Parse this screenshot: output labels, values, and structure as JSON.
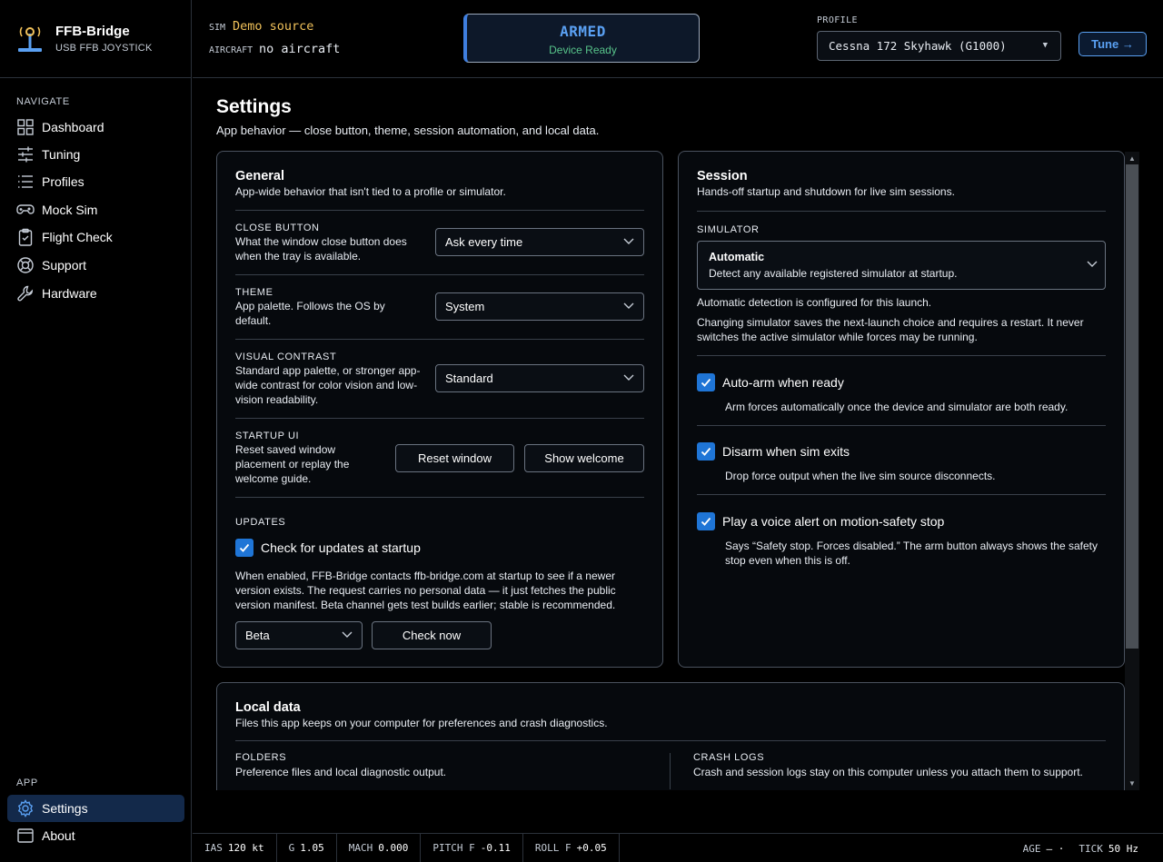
{
  "brand": {
    "title": "FFB-Bridge",
    "subtitle": "USB FFB JOYSTICK"
  },
  "nav": {
    "heading": "NAVIGATE",
    "items": [
      {
        "label": "Dashboard",
        "icon": "grid-icon"
      },
      {
        "label": "Tuning",
        "icon": "sliders-icon"
      },
      {
        "label": "Profiles",
        "icon": "list-icon"
      },
      {
        "label": "Mock Sim",
        "icon": "gamepad-icon"
      },
      {
        "label": "Flight Check",
        "icon": "clipboard-check-icon"
      },
      {
        "label": "Support",
        "icon": "lifebuoy-icon"
      },
      {
        "label": "Hardware",
        "icon": "wrench-icon"
      }
    ],
    "app_heading": "APP",
    "app_items": [
      {
        "label": "Settings",
        "icon": "gear-icon",
        "active": true
      },
      {
        "label": "About",
        "icon": "window-icon"
      }
    ]
  },
  "topbar": {
    "sim_key": "SIM",
    "sim_value": "Demo source",
    "aircraft_key": "AIRCRAFT",
    "aircraft_value": "no aircraft",
    "armed_title": "ARMED",
    "armed_sub": "Device Ready",
    "profile_label": "PROFILE",
    "profile_value": "Cessna 172 Skyhawk (G1000)",
    "tune_label": "Tune →"
  },
  "page": {
    "title": "Settings",
    "subtitle": "App behavior — close button, theme, session automation, and local data."
  },
  "general": {
    "title": "General",
    "subtitle": "App-wide behavior that isn't tied to a profile or simulator.",
    "close_button": {
      "caption": "CLOSE BUTTON",
      "desc": "What the window close button does when the tray is available.",
      "value": "Ask every time"
    },
    "theme": {
      "caption": "THEME",
      "desc": "App palette. Follows the OS by default.",
      "value": "System"
    },
    "visual_contrast": {
      "caption": "VISUAL CONTRAST",
      "desc": "Standard app palette, or stronger app-wide contrast for color vision and low-vision readability.",
      "value": "Standard"
    },
    "startup_ui": {
      "caption": "STARTUP UI",
      "desc": "Reset saved window placement or replay the welcome guide.",
      "reset_label": "Reset window",
      "welcome_label": "Show welcome"
    },
    "updates": {
      "caption": "UPDATES",
      "check_label": "Check for updates at startup",
      "checked": true,
      "desc": "When enabled, FFB-Bridge contacts ffb-bridge.com at startup to see if a newer version exists. The request carries no personal data — it just fetches the public version manifest. Beta channel gets test builds earlier; stable is recommended.",
      "channel": "Beta",
      "check_now_label": "Check now"
    }
  },
  "session": {
    "title": "Session",
    "subtitle": "Hands-off startup and shutdown for live sim sessions.",
    "simulator_caption": "SIMULATOR",
    "simulator_value": "Automatic",
    "simulator_value_desc": "Detect any available registered simulator at startup.",
    "detect_note": "Automatic detection is configured for this launch.",
    "restart_note": "Changing simulator saves the next-launch choice and requires a restart. It never switches the active simulator while forces may be running.",
    "options": [
      {
        "label": "Auto-arm when ready",
        "desc": "Arm forces automatically once the device and simulator are both ready.",
        "checked": true
      },
      {
        "label": "Disarm when sim exits",
        "desc": "Drop force output when the live sim source disconnects.",
        "checked": true
      },
      {
        "label": "Play a voice alert on motion-safety stop",
        "desc": "Says “Safety stop. Forces disabled.” The arm button always shows the safety stop even when this is off.",
        "checked": true
      }
    ]
  },
  "local_data": {
    "title": "Local data",
    "subtitle": "Files this app keeps on your computer for preferences and crash diagnostics.",
    "folders_caption": "FOLDERS",
    "folders_desc": "Preference files and local diagnostic output.",
    "crash_caption": "CRASH LOGS",
    "crash_desc": "Crash and session logs stay on this computer unless you attach them to support."
  },
  "status": {
    "ias_k": "IAS",
    "ias_v": "120 kt",
    "g_k": "G",
    "g_v": "1.05",
    "mach_k": "MACH",
    "mach_v": "0.000",
    "pitch_k": "PITCH F",
    "pitch_v": "-0.11",
    "roll_k": "ROLL F",
    "roll_v": "+0.05",
    "age_k": "AGE",
    "age_v": "—  ·",
    "tick_k": "TICK",
    "tick_v": "50 Hz"
  },
  "colors": {
    "accent": "#1f75d6",
    "armed": "#5aa0f2",
    "ready": "#58c48a",
    "sim_value": "#f0c15a"
  }
}
